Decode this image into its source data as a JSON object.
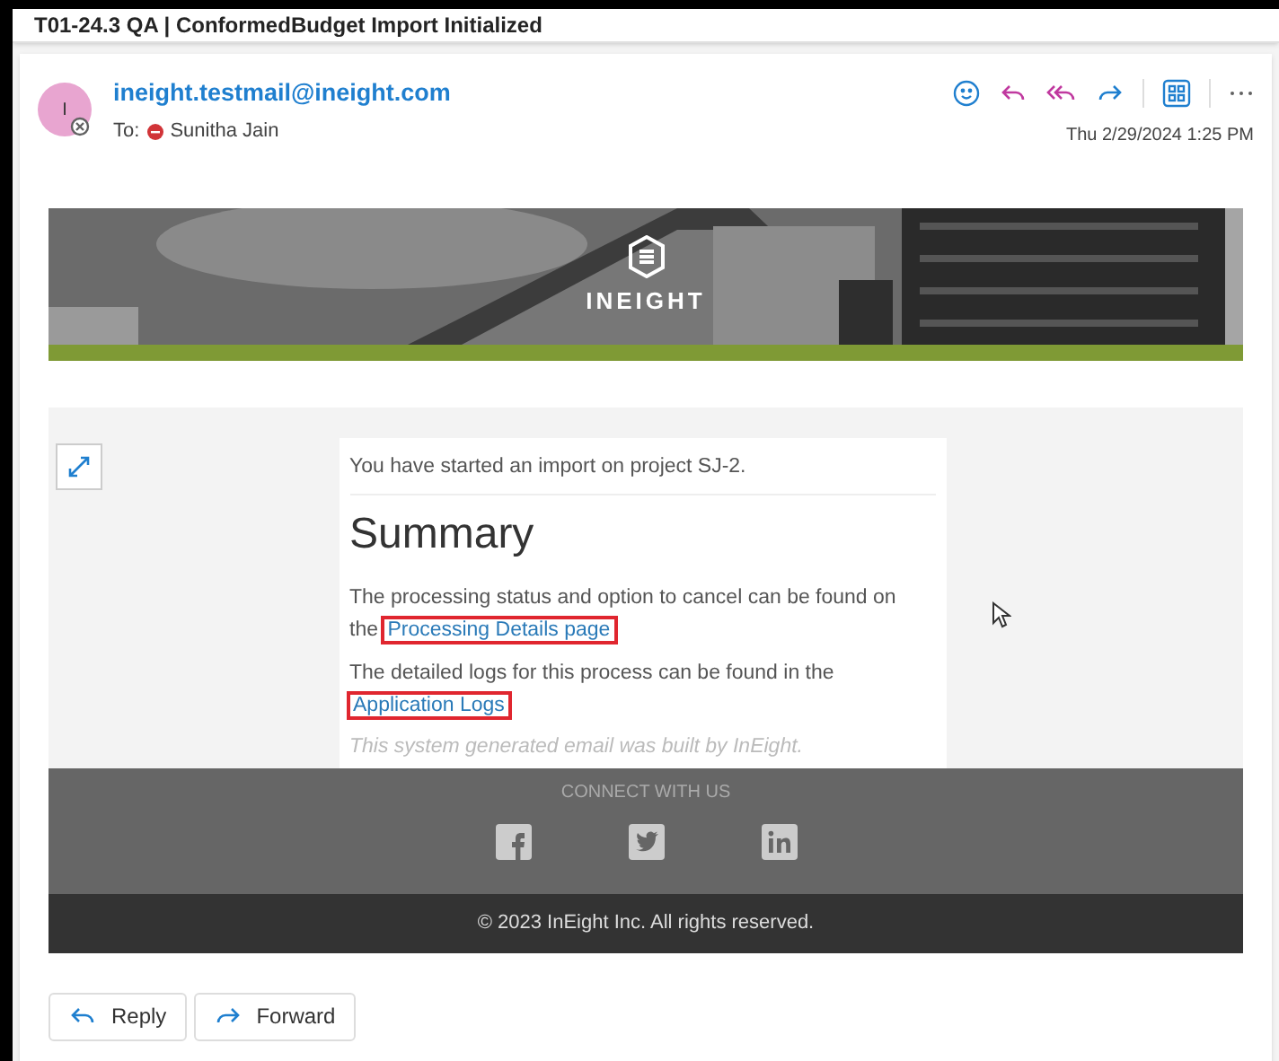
{
  "window": {
    "title": "T01-24.3 QA | ConformedBudget Import Initialized"
  },
  "message": {
    "avatar_initial": "I",
    "sender": "ineight.testmail@ineight.com",
    "to_label": "To:",
    "recipient": "Sunitha Jain",
    "date": "Thu 2/29/2024 1:25 PM"
  },
  "banner": {
    "brand": "INEIGHT"
  },
  "body": {
    "intro": "You have started an import on project SJ-2.",
    "heading": "Summary",
    "paragraphs": [
      {
        "text": "The processing status and option to cancel can be found on the",
        "link": "Processing Details page",
        "link_highlighted": true
      },
      {
        "text": "The detailed logs for this process can be found in the",
        "link": "Application Logs",
        "link_highlighted": true
      }
    ],
    "note": "This system generated email was built by InEight."
  },
  "footer": {
    "connect": "CONNECT WITH US",
    "social": [
      {
        "kind": "facebook"
      },
      {
        "kind": "twitter"
      },
      {
        "kind": "linkedin"
      }
    ],
    "copyright": "© 2023 InEight Inc. All rights reserved."
  },
  "actions": [
    {
      "kind": "reply",
      "label": "Reply"
    },
    {
      "kind": "forward",
      "label": "Forward"
    }
  ]
}
